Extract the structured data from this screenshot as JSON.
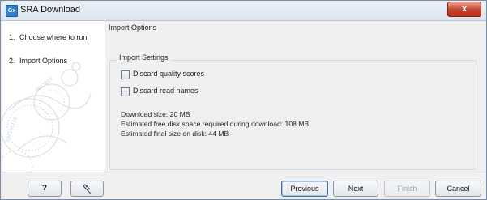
{
  "window": {
    "title": "SRA Download",
    "app_icon": "clc-app-icon",
    "app_icon_text": "Gx",
    "close_label": "x"
  },
  "sidebar": {
    "steps": [
      {
        "number": "1.",
        "label": "Choose where to run",
        "active": false
      },
      {
        "number": "2.",
        "label": "Import Options",
        "active": true
      }
    ]
  },
  "main": {
    "section_title": "Import Options",
    "group": {
      "label": "Import Settings",
      "options": [
        {
          "label": "Discard quality scores",
          "checked": false
        },
        {
          "label": "Discard read names",
          "checked": false
        }
      ],
      "info": [
        "Download size: 20 MB",
        "Estimated free disk space required during download: 108 MB",
        "Estimated final size on disk: 44 MB"
      ]
    }
  },
  "footer": {
    "help_label": "?",
    "pin_icon": "pin-icon",
    "previous_label": "Previous",
    "next_label": "Next",
    "finish_label": "Finish",
    "cancel_label": "Cancel",
    "finish_enabled": false
  },
  "colors": {
    "title_bar": "#dbe3ee",
    "close_button": "#c4402a",
    "dialog_bg": "#f0f0f0",
    "sidebar_bg": "#ffffff"
  }
}
